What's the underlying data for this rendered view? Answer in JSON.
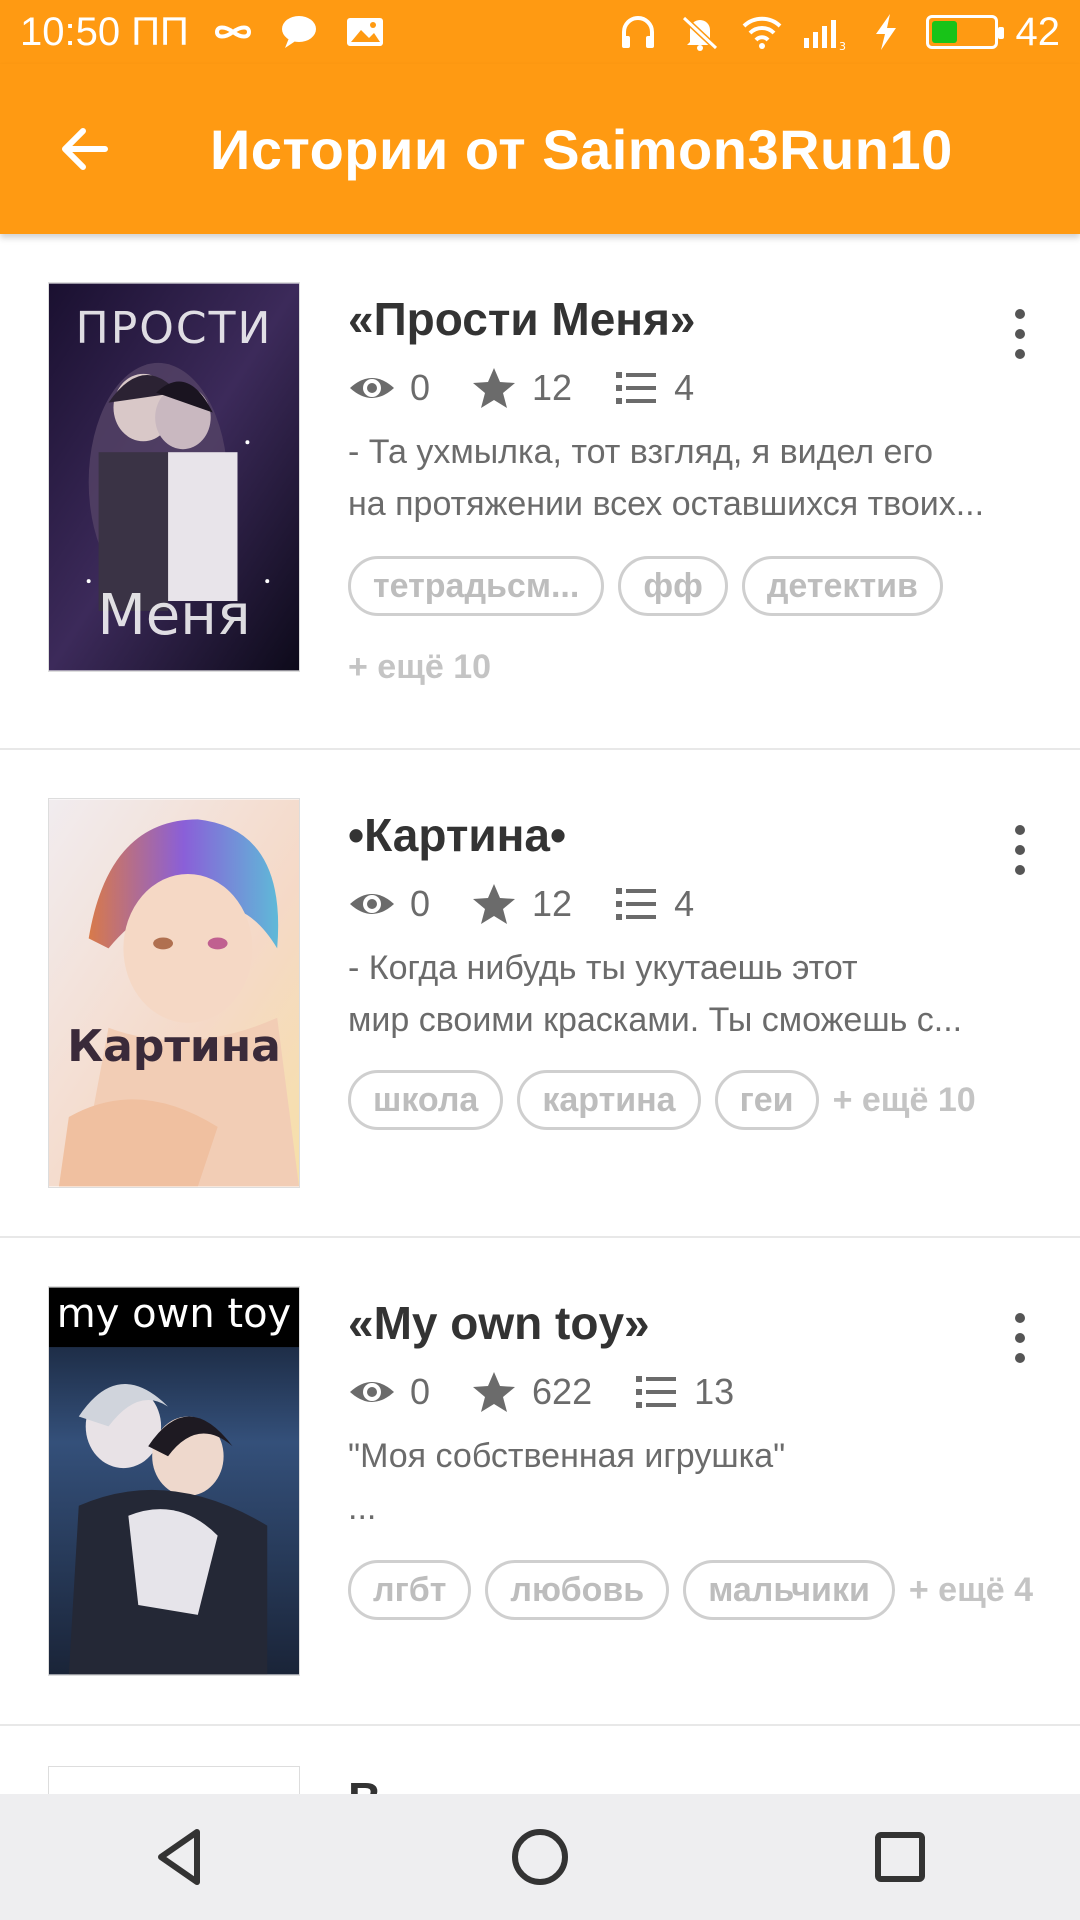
{
  "status_bar": {
    "time": "10:50 ПП",
    "battery_level": "42",
    "network": "3G",
    "colors": {
      "bar": "#ff9a12",
      "battery_fill": "#18c318"
    },
    "icons": [
      "infinity-icon",
      "chat-bubble-icon",
      "image-icon",
      "headphones-icon",
      "bell-off-icon",
      "wifi-icon",
      "signal-icon",
      "charging-icon",
      "battery-icon"
    ]
  },
  "app_bar": {
    "title": "Истории от Saimon3Run10",
    "back_icon": "arrow-left-icon"
  },
  "stories": [
    {
      "title": "«Прости Меня»",
      "views": "0",
      "votes": "12",
      "parts": "4",
      "description_lines": [
        "- Та ухмылка, тот взгляд, я видел его",
        "на протяжении всех оставшихся твоих..."
      ],
      "tags": [
        "тетрадьсм...",
        "фф",
        "детектив"
      ],
      "more_tags": "+ ещё 10",
      "cover_text_top": "ПРОСТИ",
      "cover_text_bottom": "Меня"
    },
    {
      "title": "•Картина•",
      "views": "0",
      "votes": "12",
      "parts": "4",
      "description_lines": [
        "- Когда нибудь ты укутаешь этот",
        "мир своими красками. Ты сможешь с..."
      ],
      "tags": [
        "школа",
        "картина",
        "геи"
      ],
      "more_tags": "+ ещё 10",
      "cover_text": "Картина"
    },
    {
      "title": "«My own toy»",
      "views": "0",
      "votes": "622",
      "parts": "13",
      "description_lines": [
        "\"Моя собственная игрушка\"",
        "..."
      ],
      "tags": [
        "лгбт",
        "любовь",
        "мальчики"
      ],
      "more_tags": "+ ещё 4",
      "cover_text": "my own toy"
    },
    {
      "title_partial": "В..."
    }
  ],
  "nav_bar": {
    "buttons": [
      "back-triangle-icon",
      "home-circle-icon",
      "recents-square-icon"
    ]
  }
}
